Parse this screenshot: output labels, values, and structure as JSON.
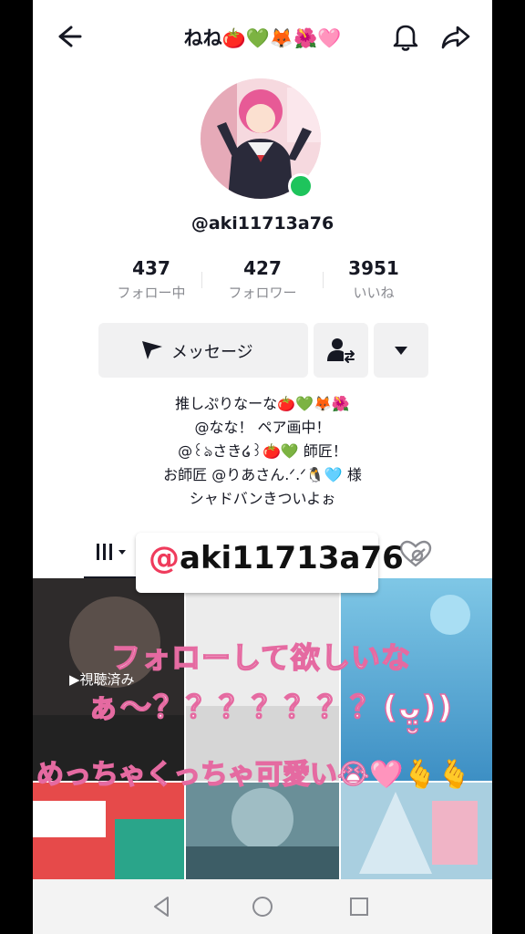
{
  "header": {
    "title": "ねね🍅💚🦊🌺🩷",
    "icons": [
      "back-arrow-icon",
      "bell-icon",
      "share-icon"
    ]
  },
  "profile": {
    "handle": "@aki11713a76",
    "online_status_color": "#1ec45c"
  },
  "stats": [
    {
      "value": "437",
      "label": "フォロー中"
    },
    {
      "value": "427",
      "label": "フォロワー"
    },
    {
      "value": "3951",
      "label": "いいね"
    }
  ],
  "actions": {
    "message_label": "メッセージ"
  },
  "bio": {
    "lines": [
      "推しぷりなーな🍅💚🦊🌺",
      "@なな！ ペア画中！",
      "@꒰ঌさき໒꒱🍅💚 師匠！",
      "お師匠 @りあさん.ᐟ.ᐟ🐧🩵 様",
      "シャドバンきついよぉ"
    ]
  },
  "banner": {
    "at": "@",
    "handle": "aki11713a76"
  },
  "videos": {
    "watched_label": "▶視聴済み"
  },
  "overlay": {
    "line1": "フォローして欲しいな",
    "line2": "ぁ〜？？？？？？？(ᴗ̤̮))",
    "line3": "めっちゃくっちゃ可愛い😭🩷🫰🫰"
  },
  "colors": {
    "accent": "#ef3b5c",
    "overlay_stroke": "#e56aa1",
    "text": "#161823",
    "secondary_text": "#8a8b91"
  }
}
